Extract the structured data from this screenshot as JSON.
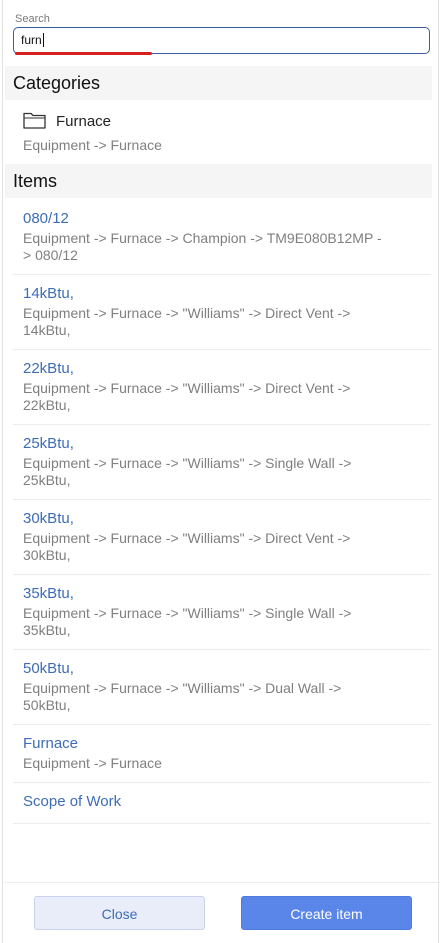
{
  "search": {
    "label": "Search",
    "value": "furn"
  },
  "categories": {
    "header": "Categories",
    "items": [
      {
        "icon": "folder-icon",
        "title": "Furnace",
        "path": "Equipment -> Furnace"
      }
    ]
  },
  "items": {
    "header": "Items",
    "list": [
      {
        "title": "080/12",
        "path": "Equipment -> Furnace -> Champion -> TM9E080B12MP -> 080/12"
      },
      {
        "title": "14kBtu,",
        "path": "Equipment -> Furnace -> \"Williams\" -> Direct Vent -> 14kBtu,"
      },
      {
        "title": "22kBtu,",
        "path": "Equipment -> Furnace -> \"Williams\" -> Direct Vent -> 22kBtu,"
      },
      {
        "title": "25kBtu,",
        "path": "Equipment -> Furnace -> \"Williams\" -> Single Wall -> 25kBtu,"
      },
      {
        "title": "30kBtu,",
        "path": "Equipment -> Furnace -> \"Williams\" -> Direct Vent -> 30kBtu,"
      },
      {
        "title": "35kBtu,",
        "path": "Equipment -> Furnace -> \"Williams\" -> Single Wall -> 35kBtu,"
      },
      {
        "title": "50kBtu,",
        "path": "Equipment -> Furnace -> \"Williams\" -> Dual Wall -> 50kBtu,"
      },
      {
        "title": "Furnace",
        "path": "Equipment -> Furnace"
      },
      {
        "title": "Scope of Work",
        "path": ""
      }
    ]
  },
  "footer": {
    "close_label": "Close",
    "create_label": "Create item"
  },
  "colors": {
    "link": "#3d6db5",
    "primary_button": "#5a86ea",
    "secondary_button": "#e8edf9",
    "annotation_underline": "#d62020"
  }
}
